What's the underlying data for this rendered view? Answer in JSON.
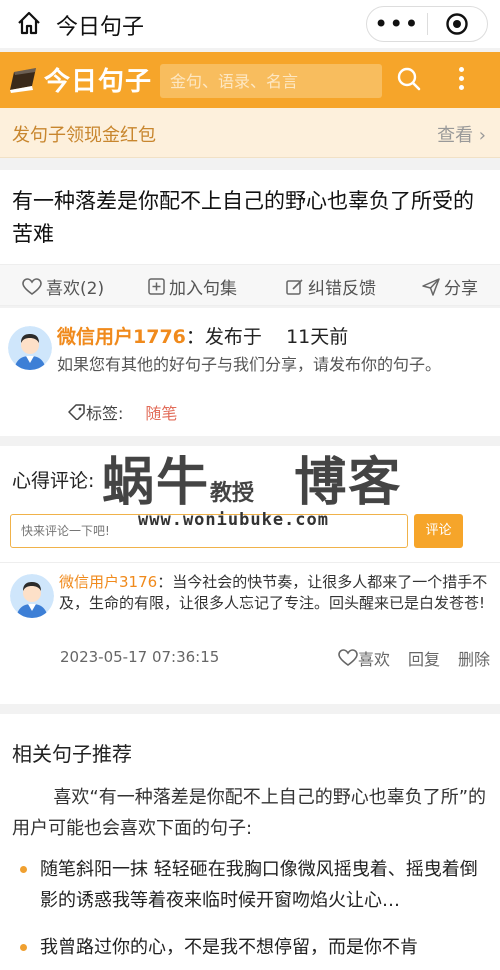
{
  "topbar": {
    "title": "今日句子",
    "more_glyph": "•••",
    "icons": [
      "home-icon",
      "more-icon",
      "target-icon"
    ]
  },
  "header": {
    "logo_text": "今日句子",
    "search_placeholder": "金句、语录、名言",
    "icons": [
      "book-logo-icon",
      "search-icon",
      "kebab-menu-icon"
    ],
    "colors": {
      "brand": "#f6a52a",
      "accent": "#f08a1c"
    }
  },
  "promo": {
    "text": "发句子领现金红包",
    "link": "查看 ›"
  },
  "sentence": {
    "text": "有一种落差是你配不上自己的野心也辜负了所受的苦难"
  },
  "actions": {
    "like": "喜欢(2)",
    "collect": "加入句集",
    "report": "纠错反馈",
    "share": "分享"
  },
  "author": {
    "name": "微信用户1776",
    "posted_prefix": "：发布于",
    "posted_time": "11天前",
    "description": "如果您有其他的好句子与我们分享，请发布你的句子。",
    "tag_label": "标签:",
    "tag_value": "随笔"
  },
  "comments": {
    "title": "心得评论:",
    "input_placeholder": "快来评论一下吧!",
    "submit": "评论",
    "items": [
      {
        "user": "微信用户3176",
        "text": "：当今社会的快节奏，让很多人都来了一个措手不及，生命的有限，让很多人忘记了专注。回头醒来已是白发苍苍!",
        "time": "2023-05-17 07:36:15",
        "like": "喜欢",
        "reply": "回复",
        "delete": "删除"
      }
    ]
  },
  "watermark": {
    "main_a": "蜗牛",
    "small": "教授",
    "main_b": "博客",
    "url": "www.woniubuke.com"
  },
  "related": {
    "title": "相关句子推荐",
    "intro": "喜欢“有一种落差是你配不上自己的野心也辜负了所”的用户可能也会喜欢下面的句子:",
    "items": [
      "随笔斜阳一抹 轻轻砸在我胸口像微风摇曳着、摇曳着倒影的诱惑我等着夜来临时候开窗吻焰火让心…",
      "我曾路过你的心，不是我不想停留，而是你不肯"
    ]
  }
}
